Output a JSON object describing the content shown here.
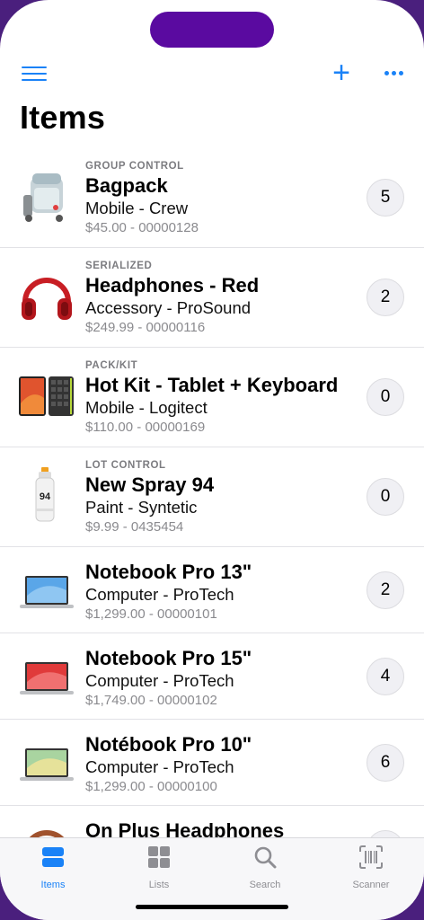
{
  "header": {
    "title": "Items"
  },
  "items": [
    {
      "category": "GROUP CONTROL",
      "name": "Bagpack",
      "subtitle": "Mobile - Crew",
      "meta": "$45.00 - 00000128",
      "count": "5",
      "image": "backpack"
    },
    {
      "category": "SERIALIZED",
      "name": "Headphones - Red",
      "subtitle": "Accessory - ProSound",
      "meta": "$249.99 - 00000116",
      "count": "2",
      "image": "headphones"
    },
    {
      "category": "PACK/KIT",
      "name": "Hot Kit - Tablet + Keyboard",
      "subtitle": "Mobile - Logitect",
      "meta": "$110.00 - 00000169",
      "count": "0",
      "image": "tablet-keyboard"
    },
    {
      "category": "LOT CONTROL",
      "name": "New Spray 94",
      "subtitle": "Paint - Syntetic",
      "meta": "$9.99 - 0435454",
      "count": "0",
      "image": "spray-can"
    },
    {
      "category": "",
      "name": "Notebook Pro 13\"",
      "subtitle": "Computer - ProTech",
      "meta": "$1,299.00 - 00000101",
      "count": "2",
      "image": "laptop-blue"
    },
    {
      "category": "",
      "name": "Notebook Pro 15\"",
      "subtitle": "Computer - ProTech",
      "meta": "$1,749.00 - 00000102",
      "count": "4",
      "image": "laptop-red"
    },
    {
      "category": "",
      "name": "Notébook Pro 10\"",
      "subtitle": "Computer - ProTech",
      "meta": "$1,299.00 - 00000100",
      "count": "6",
      "image": "laptop-green"
    },
    {
      "category": "",
      "name": "On Plus Headphones",
      "subtitle": "",
      "meta": "",
      "count": "",
      "image": "headphones-brown"
    }
  ],
  "tabs": [
    {
      "label": "Items",
      "icon": "items-icon",
      "active": true
    },
    {
      "label": "Lists",
      "icon": "grid-icon",
      "active": false
    },
    {
      "label": "Search",
      "icon": "search-icon",
      "active": false
    },
    {
      "label": "Scanner",
      "icon": "barcode-scanner-icon",
      "active": false
    }
  ],
  "colors": {
    "accent": "#1a82f7",
    "island": "#5a0aa0",
    "badge_bg": "#f0f0f4"
  }
}
